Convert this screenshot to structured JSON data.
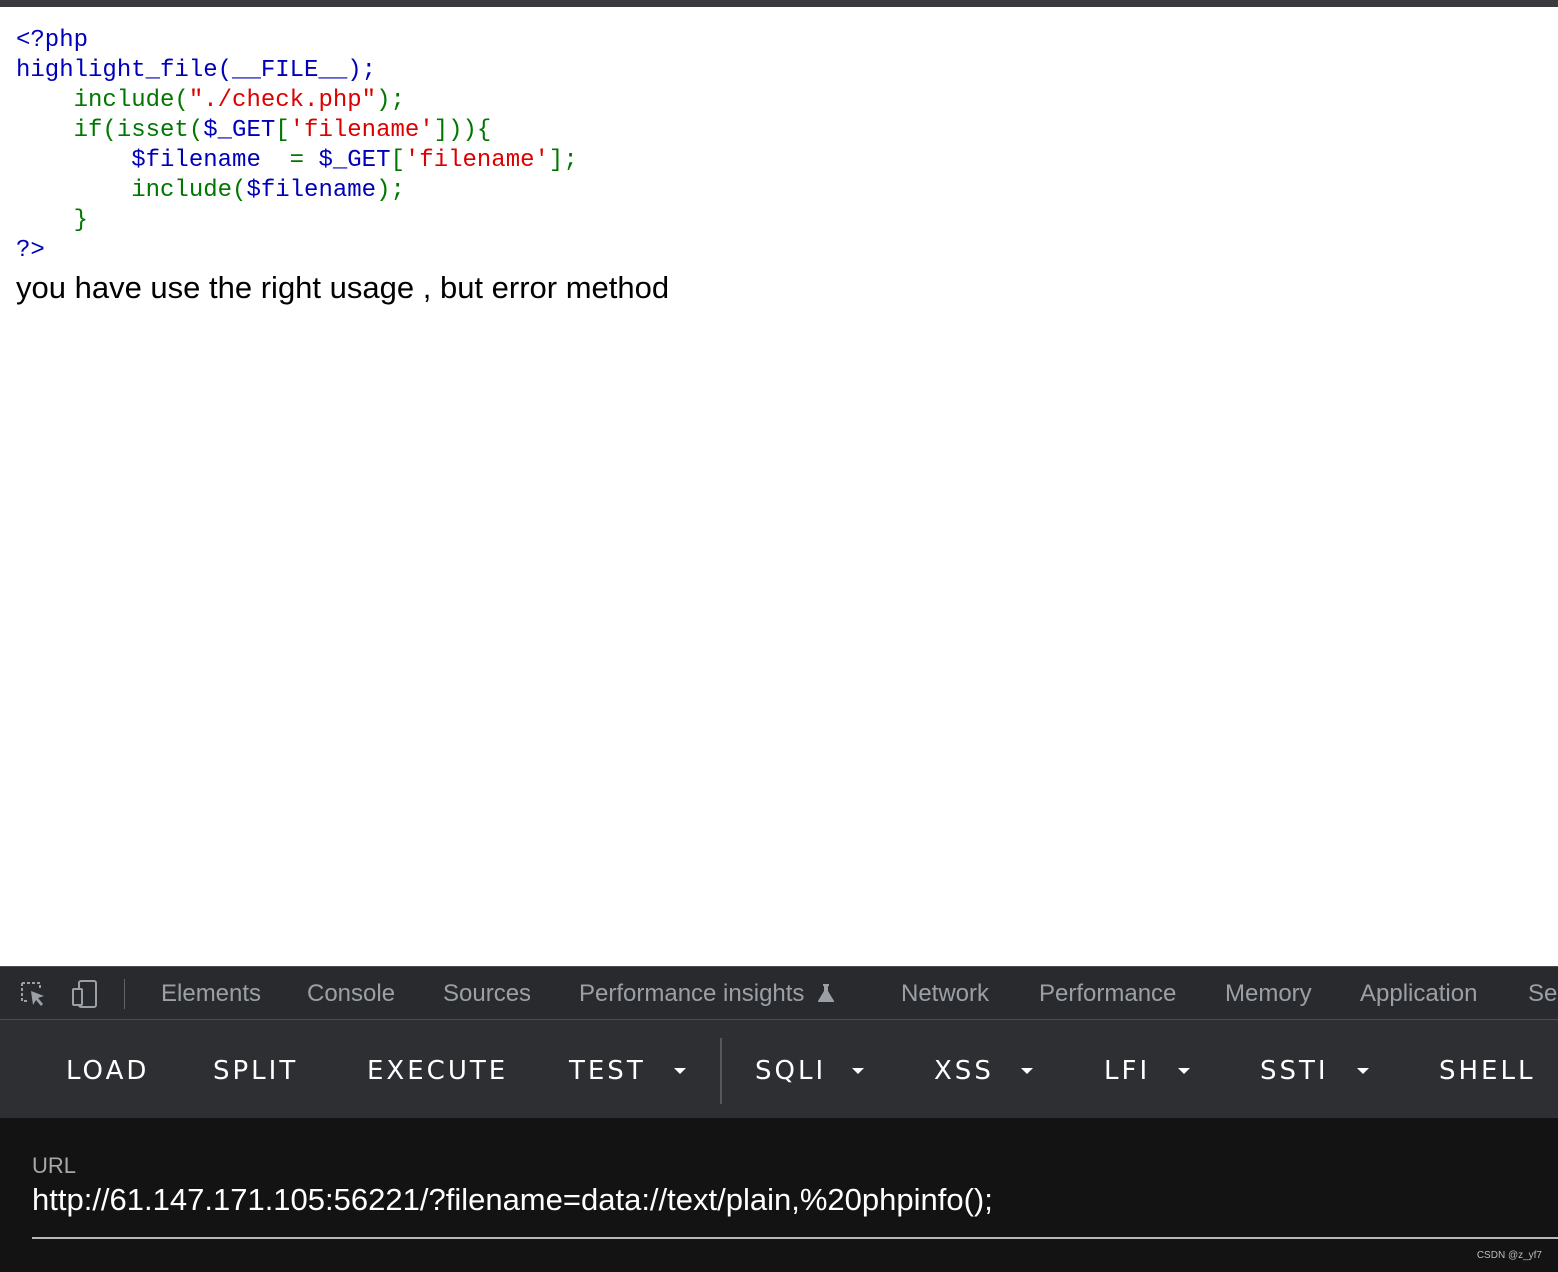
{
  "code": {
    "line1": "<?php",
    "line2_fn": "highlight_file(__FILE__);",
    "line3_pre": "    include(",
    "line3_str": "\"./check.php\"",
    "line3_post": ");",
    "line4_pre": "    if(isset(",
    "line4_var": "$_GET",
    "line4_br1": "[",
    "line4_str": "'filename'",
    "line4_post": "])){",
    "line5_var": "        $filename  ",
    "line5_eq": "= ",
    "line5_get": "$_GET",
    "line5_br1": "[",
    "line5_str": "'filename'",
    "line5_post": "];",
    "line6_pre": "        include(",
    "line6_var": "$filename",
    "line6_post": ");",
    "line7": "    }",
    "line8": "?>"
  },
  "output_text": "you have use the right usage , but error method",
  "devtools": {
    "tabs": [
      "Elements",
      "Console",
      "Sources",
      "Performance insights",
      "Network",
      "Performance",
      "Memory",
      "Application",
      "Se"
    ],
    "icons": [
      "inspect-element-icon",
      "device-toolbar-icon",
      "flask-icon"
    ]
  },
  "hackbar": {
    "buttons": [
      "LOAD",
      "SPLIT",
      "EXECUTE",
      "TEST",
      "SQLI",
      "XSS",
      "LFI",
      "SSTI",
      "SHELL"
    ],
    "url_label": "URL",
    "url_value": "http://61.147.171.105:56221/?filename=data://text/plain,%20phpinfo();"
  },
  "watermark": "CSDN @z_yf7"
}
